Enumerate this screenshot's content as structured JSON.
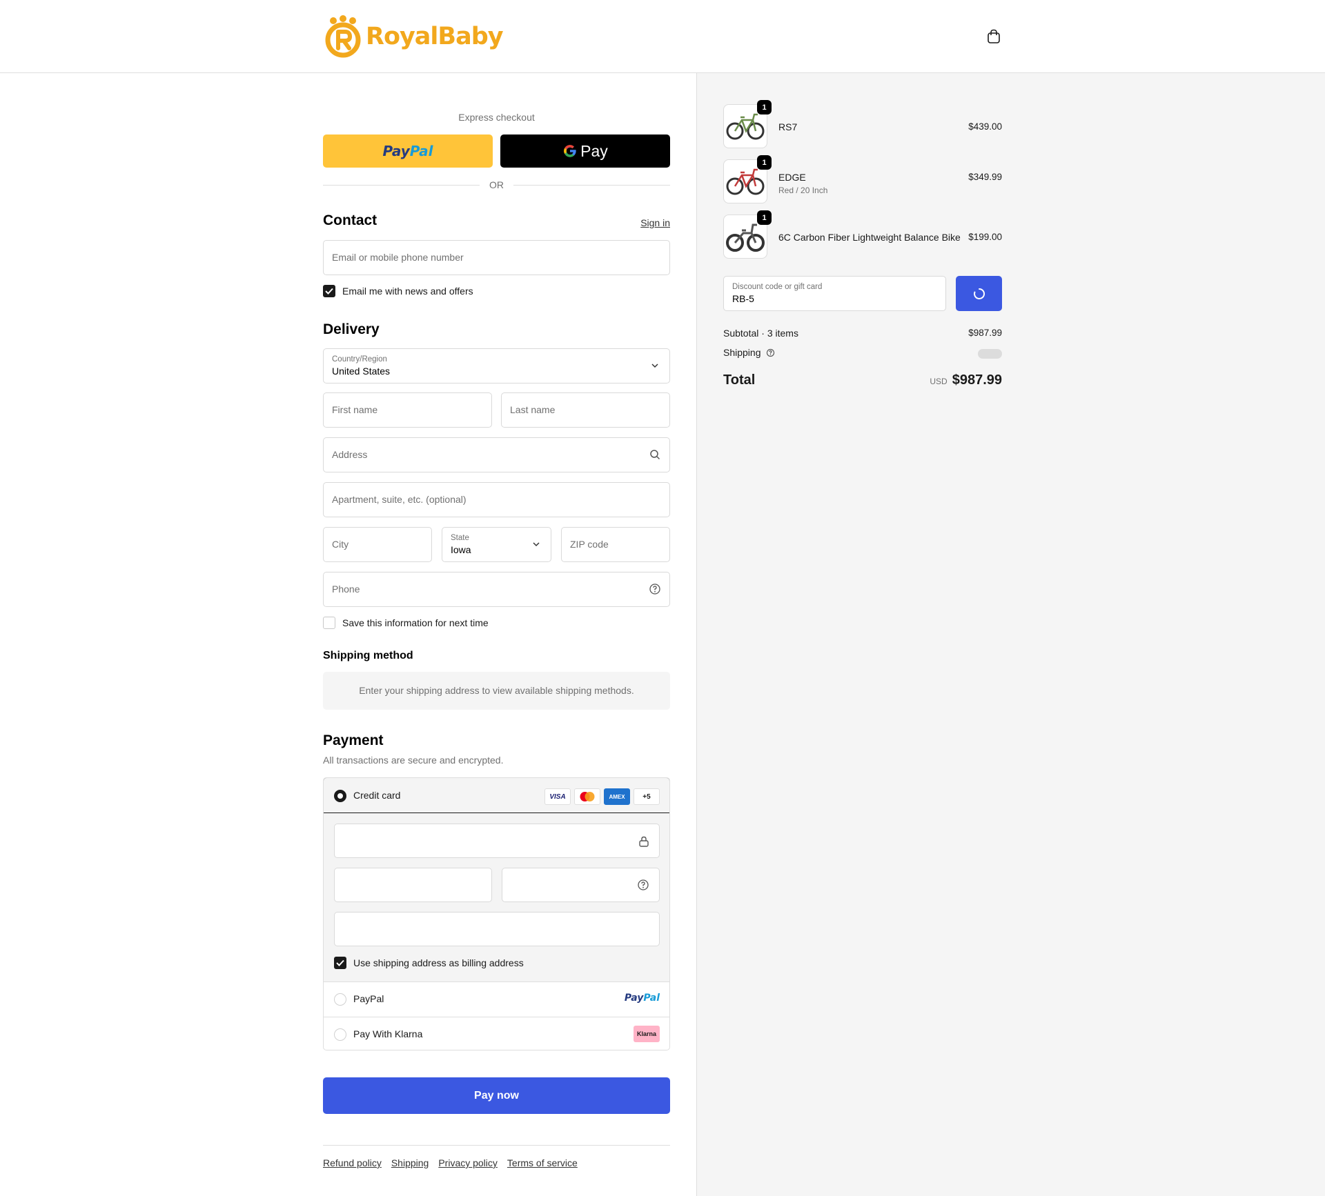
{
  "header": {
    "logo_text": "RoyalBaby",
    "brand_color": "#f2a81d",
    "cart_icon": "shopping-bag-icon"
  },
  "express": {
    "title": "Express checkout",
    "paypal_a": "Pay",
    "paypal_b": "Pal",
    "gpay_label": "Pay",
    "or_label": "OR"
  },
  "contact": {
    "heading": "Contact",
    "sign_in": "Sign in",
    "email_placeholder": "Email or mobile phone number",
    "news_label": "Email me with news and offers",
    "news_checked": true
  },
  "delivery": {
    "heading": "Delivery",
    "country_label": "Country/Region",
    "country_value": "United States",
    "first_name_placeholder": "First name",
    "last_name_placeholder": "Last name",
    "address_placeholder": "Address",
    "apartment_placeholder": "Apartment, suite, etc. (optional)",
    "city_placeholder": "City",
    "state_label": "State",
    "state_value": "Iowa",
    "zip_placeholder": "ZIP code",
    "phone_placeholder": "Phone",
    "save_label": "Save this information for next time",
    "save_checked": false
  },
  "shipping_method": {
    "heading": "Shipping method",
    "info": "Enter your shipping address to view available shipping methods."
  },
  "payment": {
    "heading": "Payment",
    "subtitle": "All transactions are secure and encrypted.",
    "credit_card_label": "Credit card",
    "card_brands": [
      "VISA",
      "mastercard",
      "AMEX",
      "+5"
    ],
    "billing_label": "Use shipping address as billing address",
    "billing_checked": true,
    "paypal_label": "PayPal",
    "paypal_logo_a": "Pay",
    "paypal_logo_b": "Pal",
    "klarna_label": "Pay With Klarna",
    "klarna_logo": "Klarna",
    "klarna_color": "#ffb3c7"
  },
  "pay_now": "Pay now",
  "footer": {
    "links": [
      "Refund policy",
      "Shipping",
      "Privacy policy",
      "Terms of service"
    ]
  },
  "order": {
    "items": [
      {
        "name": "RS7",
        "variant": "",
        "qty": "1",
        "price": "$439.00"
      },
      {
        "name": "EDGE",
        "variant": "Red / 20 Inch",
        "qty": "1",
        "price": "$349.99"
      },
      {
        "name": "6C Carbon Fiber Lightweight Balance Bike",
        "variant": "",
        "qty": "1",
        "price": "$199.00"
      }
    ],
    "discount_label": "Discount code or gift card",
    "discount_value": "RB-5",
    "subtotal_label": "Subtotal · 3 items",
    "subtotal_value": "$987.99",
    "shipping_label": "Shipping",
    "total_label": "Total",
    "currency": "USD",
    "total_value": "$987.99",
    "accent_color": "#3b58e1"
  }
}
